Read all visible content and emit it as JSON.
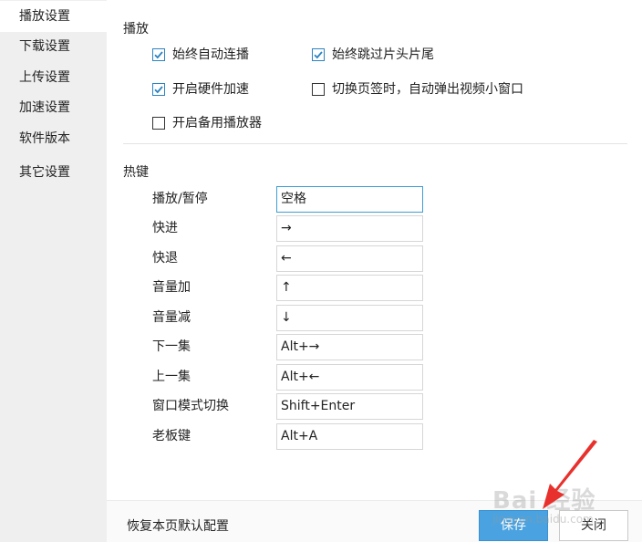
{
  "sidebar": {
    "items": [
      {
        "label": "播放设置",
        "active": true
      },
      {
        "label": "下载设置"
      },
      {
        "label": "上传设置"
      },
      {
        "label": "加速设置"
      },
      {
        "label": "软件版本"
      },
      {
        "label": "其它设置"
      }
    ]
  },
  "playback": {
    "title": "播放",
    "options": [
      {
        "label": "始终自动连播",
        "checked": true
      },
      {
        "label": "始终跳过片头片尾",
        "checked": true
      },
      {
        "label": "开启硬件加速",
        "checked": true
      },
      {
        "label": "切换页签时，自动弹出视频小窗口",
        "checked": false
      },
      {
        "label": "开启备用播放器",
        "checked": false
      }
    ]
  },
  "hotkeys": {
    "title": "热键",
    "rows": [
      {
        "label": "播放/暂停",
        "value": "空格"
      },
      {
        "label": "快进",
        "value": "→"
      },
      {
        "label": "快退",
        "value": "←"
      },
      {
        "label": "音量加",
        "value": "↑"
      },
      {
        "label": "音量减",
        "value": "↓"
      },
      {
        "label": "下一集",
        "value": "Alt+→"
      },
      {
        "label": "上一集",
        "value": "Alt+←"
      },
      {
        "label": "窗口模式切换",
        "value": "Shift+Enter"
      },
      {
        "label": "老板键",
        "value": "Alt+A"
      }
    ]
  },
  "footer": {
    "restore_label": "恢复本页默认配置",
    "save_label": "保存",
    "close_label": "关闭"
  },
  "watermark": {
    "brand": "Bai 经验",
    "site": "jingyan.baidu.com"
  },
  "colors": {
    "accent": "#4aa3e0",
    "check": "#2b83c2",
    "annotation_arrow": "#e8312c"
  }
}
